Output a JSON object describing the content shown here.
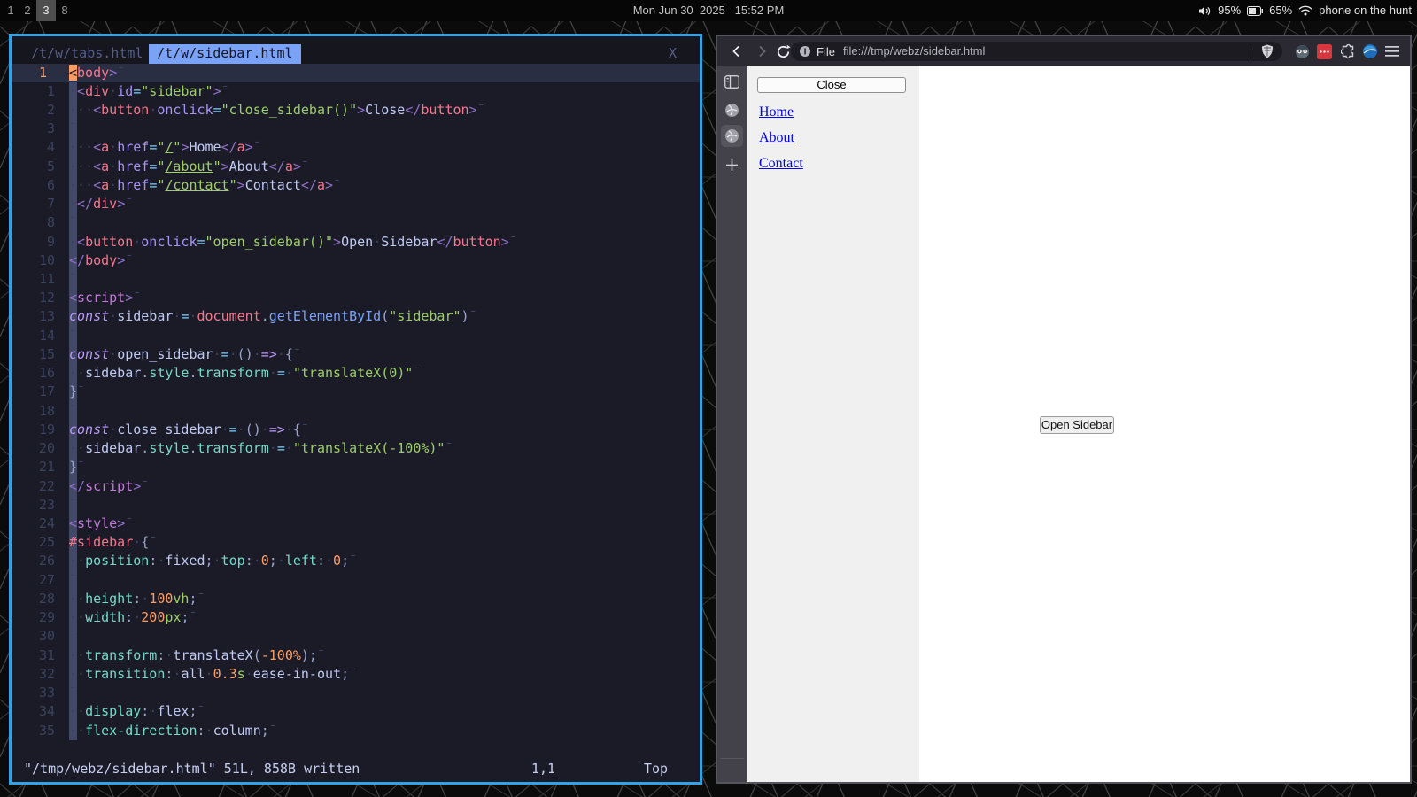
{
  "topbar": {
    "workspaces": [
      "1",
      "2",
      "3",
      "8"
    ],
    "active_workspace": "3",
    "clock": "Mon Jun 30  2025   15:52 PM",
    "volume": "95%",
    "battery": "65%",
    "network": "phone on the hunt"
  },
  "editor": {
    "tabs": [
      {
        "label": "/t/w/tabs.html",
        "active": false
      },
      {
        "label": "/t/w/sidebar.html",
        "active": true
      }
    ],
    "close_label": "X",
    "cmdline_message": "\"/tmp/webz/sidebar.html\" 51L, 858B written",
    "ruler": "1,1",
    "scroll_position": "Top",
    "accent_border": "#2fa3e6",
    "lines": [
      {
        "n": "1",
        "cur": true,
        "t": [
          [
            "cur",
            "<"
          ],
          [
            "tag",
            "body"
          ],
          [
            "dl",
            ">"
          ],
          [
            "eol",
            "¯"
          ]
        ]
      },
      {
        "n": "1",
        "t": [
          [
            "ws",
            "·"
          ],
          [
            "dl",
            "<"
          ],
          [
            "tag",
            "div"
          ],
          [
            "ws",
            "·"
          ],
          [
            "attr",
            "id"
          ],
          [
            "op",
            "="
          ],
          [
            "str",
            "\"sidebar\""
          ],
          [
            "dl",
            ">"
          ],
          [
            "eol",
            "¯"
          ]
        ]
      },
      {
        "n": "2",
        "t": [
          [
            "ws",
            "···"
          ],
          [
            "dl",
            "<"
          ],
          [
            "tag",
            "button"
          ],
          [
            "ws",
            "·"
          ],
          [
            "attr",
            "onclick"
          ],
          [
            "op",
            "="
          ],
          [
            "str",
            "\"close_sidebar()\""
          ],
          [
            "dl",
            ">"
          ],
          [
            "txt",
            "Close"
          ],
          [
            "dl",
            "</"
          ],
          [
            "tag",
            "button"
          ],
          [
            "dl",
            ">"
          ],
          [
            "eol",
            "¯"
          ]
        ]
      },
      {
        "n": "3",
        "t": [
          [
            "eol",
            "¯"
          ]
        ]
      },
      {
        "n": "4",
        "t": [
          [
            "ws",
            "···"
          ],
          [
            "dl",
            "<"
          ],
          [
            "tag",
            "a"
          ],
          [
            "ws",
            "·"
          ],
          [
            "attr",
            "href"
          ],
          [
            "op",
            "="
          ],
          [
            "str",
            "\""
          ],
          [
            "url",
            "/"
          ],
          [
            "str",
            "\""
          ],
          [
            "dl",
            ">"
          ],
          [
            "txt",
            "Home"
          ],
          [
            "dl",
            "</"
          ],
          [
            "tag",
            "a"
          ],
          [
            "dl",
            ">"
          ],
          [
            "eol",
            "¯"
          ]
        ]
      },
      {
        "n": "5",
        "t": [
          [
            "ws",
            "···"
          ],
          [
            "dl",
            "<"
          ],
          [
            "tag",
            "a"
          ],
          [
            "ws",
            "·"
          ],
          [
            "attr",
            "href"
          ],
          [
            "op",
            "="
          ],
          [
            "str",
            "\""
          ],
          [
            "url",
            "/about"
          ],
          [
            "str",
            "\""
          ],
          [
            "dl",
            ">"
          ],
          [
            "txt",
            "About"
          ],
          [
            "dl",
            "</"
          ],
          [
            "tag",
            "a"
          ],
          [
            "dl",
            ">"
          ],
          [
            "eol",
            "¯"
          ]
        ]
      },
      {
        "n": "6",
        "t": [
          [
            "ws",
            "···"
          ],
          [
            "dl",
            "<"
          ],
          [
            "tag",
            "a"
          ],
          [
            "ws",
            "·"
          ],
          [
            "attr",
            "href"
          ],
          [
            "op",
            "="
          ],
          [
            "str",
            "\""
          ],
          [
            "url",
            "/contact"
          ],
          [
            "str",
            "\""
          ],
          [
            "dl",
            ">"
          ],
          [
            "txt",
            "Contact"
          ],
          [
            "dl",
            "</"
          ],
          [
            "tag",
            "a"
          ],
          [
            "dl",
            ">"
          ],
          [
            "eol",
            "¯"
          ]
        ]
      },
      {
        "n": "7",
        "t": [
          [
            "ws",
            "·"
          ],
          [
            "dl",
            "</"
          ],
          [
            "tag",
            "div"
          ],
          [
            "dl",
            ">"
          ],
          [
            "eol",
            "¯"
          ]
        ]
      },
      {
        "n": "8",
        "t": [
          [
            "eol",
            "¯"
          ]
        ]
      },
      {
        "n": "9",
        "t": [
          [
            "ws",
            "·"
          ],
          [
            "dl",
            "<"
          ],
          [
            "tag",
            "button"
          ],
          [
            "ws",
            "·"
          ],
          [
            "attr",
            "onclick"
          ],
          [
            "op",
            "="
          ],
          [
            "str",
            "\"open_sidebar()\""
          ],
          [
            "dl",
            ">"
          ],
          [
            "txt",
            "Open"
          ],
          [
            "ws",
            "·"
          ],
          [
            "txt",
            "Sidebar"
          ],
          [
            "dl",
            "</"
          ],
          [
            "tag",
            "button"
          ],
          [
            "dl",
            ">"
          ],
          [
            "eol",
            "¯"
          ]
        ]
      },
      {
        "n": "10",
        "t": [
          [
            "dl",
            "</"
          ],
          [
            "tag",
            "body"
          ],
          [
            "dl",
            ">"
          ],
          [
            "eol",
            "¯"
          ]
        ]
      },
      {
        "n": "11",
        "t": [
          [
            "eol",
            "¯"
          ]
        ]
      },
      {
        "n": "12",
        "t": [
          [
            "dl",
            "<"
          ],
          [
            "stag",
            "script"
          ],
          [
            "dl",
            ">"
          ],
          [
            "eol",
            "¯"
          ]
        ]
      },
      {
        "n": "13",
        "t": [
          [
            "kw",
            "const"
          ],
          [
            "ws",
            "·"
          ],
          [
            "txt",
            "sidebar"
          ],
          [
            "ws",
            "·"
          ],
          [
            "op",
            "="
          ],
          [
            "ws",
            "·"
          ],
          [
            "bi",
            "document"
          ],
          [
            "pn",
            "."
          ],
          [
            "fn",
            "getElementById"
          ],
          [
            "pn",
            "("
          ],
          [
            "str",
            "\"sidebar\""
          ],
          [
            "pn",
            ")"
          ],
          [
            "eol",
            "¯"
          ]
        ]
      },
      {
        "n": "14",
        "t": [
          [
            "eol",
            "¯"
          ]
        ]
      },
      {
        "n": "15",
        "t": [
          [
            "kw",
            "const"
          ],
          [
            "ws",
            "·"
          ],
          [
            "txt",
            "open_sidebar"
          ],
          [
            "ws",
            "·"
          ],
          [
            "op",
            "="
          ],
          [
            "ws",
            "·"
          ],
          [
            "pn",
            "()"
          ],
          [
            "ws",
            "·"
          ],
          [
            "ar",
            "=>"
          ],
          [
            "ws",
            "·"
          ],
          [
            "pn",
            "{"
          ],
          [
            "eol",
            "¯"
          ]
        ]
      },
      {
        "n": "16",
        "t": [
          [
            "ws",
            "··"
          ],
          [
            "txt",
            "sidebar"
          ],
          [
            "pn",
            "."
          ],
          [
            "prop",
            "style"
          ],
          [
            "pn",
            "."
          ],
          [
            "prop",
            "transform"
          ],
          [
            "ws",
            "·"
          ],
          [
            "op",
            "="
          ],
          [
            "ws",
            "·"
          ],
          [
            "str",
            "\"translateX(0)\""
          ],
          [
            "eol",
            "¯"
          ]
        ]
      },
      {
        "n": "17",
        "t": [
          [
            "pn",
            "}"
          ],
          [
            "eol",
            "¯"
          ]
        ]
      },
      {
        "n": "18",
        "t": [
          [
            "eol",
            "¯"
          ]
        ]
      },
      {
        "n": "19",
        "t": [
          [
            "kw",
            "const"
          ],
          [
            "ws",
            "·"
          ],
          [
            "txt",
            "close_sidebar"
          ],
          [
            "ws",
            "·"
          ],
          [
            "op",
            "="
          ],
          [
            "ws",
            "·"
          ],
          [
            "pn",
            "()"
          ],
          [
            "ws",
            "·"
          ],
          [
            "ar",
            "=>"
          ],
          [
            "ws",
            "·"
          ],
          [
            "pn",
            "{"
          ],
          [
            "eol",
            "¯"
          ]
        ]
      },
      {
        "n": "20",
        "t": [
          [
            "ws",
            "··"
          ],
          [
            "txt",
            "sidebar"
          ],
          [
            "pn",
            "."
          ],
          [
            "prop",
            "style"
          ],
          [
            "pn",
            "."
          ],
          [
            "prop",
            "transform"
          ],
          [
            "ws",
            "·"
          ],
          [
            "op",
            "="
          ],
          [
            "ws",
            "·"
          ],
          [
            "str",
            "\"translateX(-100%)\""
          ],
          [
            "eol",
            "¯"
          ]
        ]
      },
      {
        "n": "21",
        "t": [
          [
            "pn",
            "}"
          ],
          [
            "eol",
            "¯"
          ]
        ]
      },
      {
        "n": "22",
        "t": [
          [
            "dl",
            "</"
          ],
          [
            "stag",
            "script"
          ],
          [
            "dl",
            ">"
          ],
          [
            "eol",
            "¯"
          ]
        ]
      },
      {
        "n": "23",
        "t": [
          [
            "eol",
            "¯"
          ]
        ]
      },
      {
        "n": "24",
        "t": [
          [
            "dl",
            "<"
          ],
          [
            "stag",
            "style"
          ],
          [
            "dl",
            ">"
          ],
          [
            "eol",
            "¯"
          ]
        ]
      },
      {
        "n": "25",
        "t": [
          [
            "id",
            "#sidebar"
          ],
          [
            "ws",
            "·"
          ],
          [
            "pn",
            "{"
          ],
          [
            "eol",
            "¯"
          ]
        ]
      },
      {
        "n": "26",
        "t": [
          [
            "ws",
            "··"
          ],
          [
            "prop",
            "position"
          ],
          [
            "pn",
            ":"
          ],
          [
            "ws",
            "·"
          ],
          [
            "txt",
            "fixed"
          ],
          [
            "pn",
            ";"
          ],
          [
            "ws",
            "·"
          ],
          [
            "prop",
            "top"
          ],
          [
            "pn",
            ":"
          ],
          [
            "ws",
            "·"
          ],
          [
            "num",
            "0"
          ],
          [
            "pn",
            ";"
          ],
          [
            "ws",
            "·"
          ],
          [
            "prop",
            "left"
          ],
          [
            "pn",
            ":"
          ],
          [
            "ws",
            "·"
          ],
          [
            "num",
            "0"
          ],
          [
            "pn",
            ";"
          ],
          [
            "eol",
            "¯"
          ]
        ]
      },
      {
        "n": "27",
        "t": [
          [
            "eol",
            "¯"
          ]
        ]
      },
      {
        "n": "28",
        "t": [
          [
            "ws",
            "··"
          ],
          [
            "prop",
            "height"
          ],
          [
            "pn",
            ":"
          ],
          [
            "ws",
            "·"
          ],
          [
            "num",
            "100"
          ],
          [
            "unit",
            "vh"
          ],
          [
            "pn",
            ";"
          ],
          [
            "eol",
            "¯"
          ]
        ]
      },
      {
        "n": "29",
        "t": [
          [
            "ws",
            "··"
          ],
          [
            "prop",
            "width"
          ],
          [
            "pn",
            ":"
          ],
          [
            "ws",
            "·"
          ],
          [
            "num",
            "200"
          ],
          [
            "unit",
            "px"
          ],
          [
            "pn",
            ";"
          ],
          [
            "eol",
            "¯"
          ]
        ]
      },
      {
        "n": "30",
        "t": [
          [
            "eol",
            "¯"
          ]
        ]
      },
      {
        "n": "31",
        "t": [
          [
            "ws",
            "··"
          ],
          [
            "prop",
            "transform"
          ],
          [
            "pn",
            ":"
          ],
          [
            "ws",
            "·"
          ],
          [
            "txt",
            "translateX"
          ],
          [
            "pn",
            "("
          ],
          [
            "num",
            "-100%"
          ],
          [
            "pn",
            ");"
          ],
          [
            "eol",
            "¯"
          ]
        ]
      },
      {
        "n": "32",
        "t": [
          [
            "ws",
            "··"
          ],
          [
            "prop",
            "transition"
          ],
          [
            "pn",
            ":"
          ],
          [
            "ws",
            "·"
          ],
          [
            "txt",
            "all"
          ],
          [
            "ws",
            "·"
          ],
          [
            "num",
            "0.3"
          ],
          [
            "unit",
            "s"
          ],
          [
            "ws",
            "·"
          ],
          [
            "txt",
            "ease-in-out"
          ],
          [
            "pn",
            ";"
          ],
          [
            "eol",
            "¯"
          ]
        ]
      },
      {
        "n": "33",
        "t": [
          [
            "eol",
            "¯"
          ]
        ]
      },
      {
        "n": "34",
        "t": [
          [
            "ws",
            "··"
          ],
          [
            "prop",
            "display"
          ],
          [
            "pn",
            ":"
          ],
          [
            "ws",
            "·"
          ],
          [
            "txt",
            "flex"
          ],
          [
            "pn",
            ";"
          ],
          [
            "eol",
            "¯"
          ]
        ]
      },
      {
        "n": "35",
        "t": [
          [
            "ws",
            "··"
          ],
          [
            "prop",
            "flex-direction"
          ],
          [
            "pn",
            ":"
          ],
          [
            "ws",
            "·"
          ],
          [
            "txt",
            "column"
          ],
          [
            "pn",
            ";"
          ],
          [
            "eol",
            "¯"
          ]
        ]
      }
    ]
  },
  "browser": {
    "identity_label": "File",
    "url": "file:///tmp/webz/sidebar.html",
    "page": {
      "close_button": "Close",
      "links": [
        "Home",
        "About",
        "Contact"
      ],
      "open_button": "Open Sidebar",
      "link_color": "#0000e0",
      "sidebar_bg": "#f0f0f0"
    }
  }
}
